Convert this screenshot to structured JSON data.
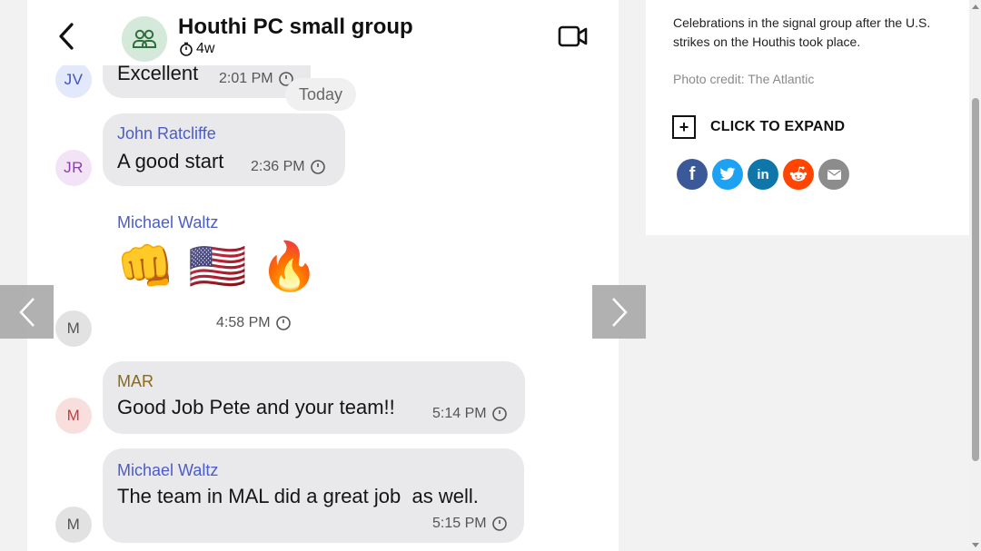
{
  "chat": {
    "title": "Houthi PC small group",
    "timer": "4w",
    "today_chip": "Today",
    "messages": [
      {
        "avatar": "JV",
        "text": "Excellent",
        "time": "2:01 PM"
      },
      {
        "avatar": "JR",
        "sender": "John Ratcliffe",
        "text": "A good start",
        "time": "2:36 PM"
      },
      {
        "avatar": "M",
        "sender": "Michael Waltz",
        "emojis": "👊 🇺🇸 🔥",
        "time": "4:58 PM"
      },
      {
        "avatar": "M",
        "sender": "MAR",
        "text": "Good Job Pete and your team!!",
        "time": "5:14 PM"
      },
      {
        "avatar": "M",
        "sender": "Michael Waltz",
        "text": "The team in MAL did a great job  as well.",
        "time": "5:15 PM"
      }
    ]
  },
  "caption": {
    "text": "Celebrations in the signal group after the U.S. strikes on the Houthis took place.",
    "credit": "Photo credit: The Atlantic",
    "expand_label": "CLICK TO EXPAND",
    "expand_symbol": "+"
  },
  "share": {
    "facebook": "f",
    "linkedin": "in"
  },
  "colors": {
    "sender_blue": "#4a5cc9",
    "sender_gold": "#8a6a18",
    "bubble": "#e9e9eb",
    "facebook": "#3b5998",
    "twitter": "#1da1f2",
    "linkedin": "#0e76a8",
    "reddit": "#ff4500",
    "email": "#8c8c8c"
  }
}
